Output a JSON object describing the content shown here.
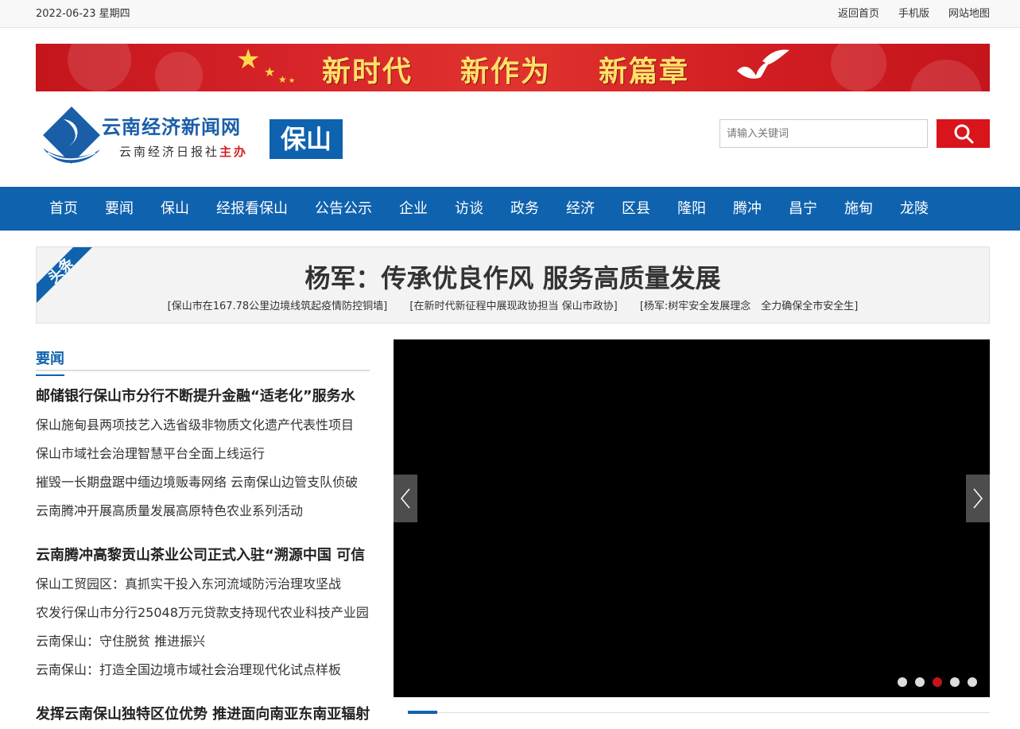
{
  "topbar": {
    "date": "2022-06-23 星期四",
    "links": [
      "返回首页",
      "手机版",
      "网站地图"
    ]
  },
  "banner": {
    "words": [
      "新时代",
      "新作为",
      "新篇章"
    ]
  },
  "logo": {
    "title": "云南经济新闻网",
    "sub_prefix": "云南经济日报社",
    "sub_suffix": "主办",
    "city": "保山"
  },
  "search": {
    "placeholder": "请输入关键词",
    "icon": "search-icon"
  },
  "nav": {
    "items": [
      "首页",
      "要闻",
      "保山",
      "经报看保山",
      "公告公示",
      "企业",
      "访谈",
      "政务",
      "经济",
      "区县",
      "隆阳",
      "腾冲",
      "昌宁",
      "施甸",
      "龙陵"
    ]
  },
  "headline": {
    "tag": "头条",
    "title": "杨军：传承优良作风 服务高质量发展",
    "subs": [
      "[保山市在167.78公里边境线筑起疫情防控铜墙]",
      "[在新时代新征程中展现政协担当 保山市政协]",
      "[杨军:树牢安全发展理念　全力确保全市安全生]"
    ]
  },
  "news": {
    "section_title": "要闻",
    "groups": [
      {
        "lead": "邮储银行保山市分行不断提升金融“适老化”服务水",
        "items": [
          "保山施甸县两项技艺入选省级非物质文化遗产代表性项目",
          "保山市域社会治理智慧平台全面上线运行",
          "摧毁一长期盘踞中缅边境贩毒网络 云南保山边管支队侦破",
          "云南腾冲开展高质量发展高原特色农业系列活动"
        ]
      },
      {
        "lead": "云南腾冲高黎贡山茶业公司正式入驻“溯源中国 可信",
        "items": [
          "保山工贸园区：真抓实干投入东河流域防污治理攻坚战",
          "农发行保山市分行25048万元贷款支持现代农业科技产业园",
          "云南保山：守住脱贫 推进振兴",
          "云南保山：打造全国边境市域社会治理现代化试点样板"
        ]
      },
      {
        "lead": "发挥云南保山独特区位优势 推进面向南亚东南亚辐射",
        "items": []
      }
    ]
  },
  "slider": {
    "dot_count": 5,
    "active_dot": 3
  },
  "colors": {
    "brand_blue": "#0f62ae",
    "accent_red": "#d9141b"
  }
}
